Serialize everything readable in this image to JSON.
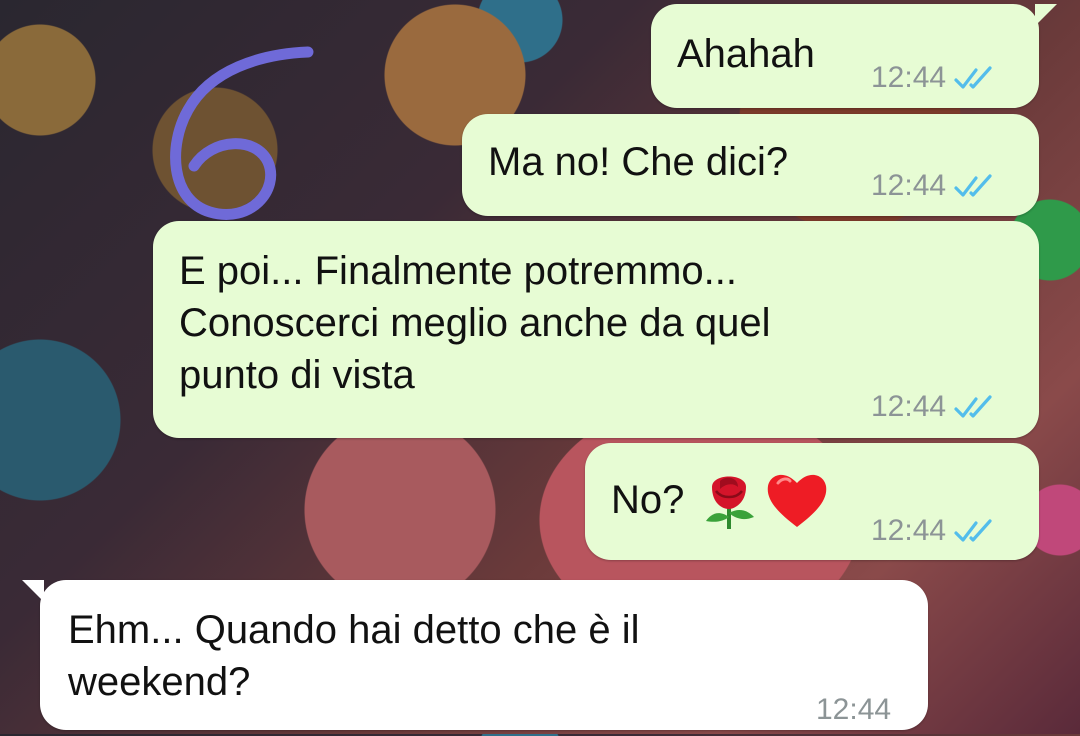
{
  "messages": [
    {
      "id": "m1",
      "direction": "outgoing",
      "text": "Ahahah",
      "time": "12:44",
      "status": "read"
    },
    {
      "id": "m2",
      "direction": "outgoing",
      "text": "Ma no! Che dici?",
      "time": "12:44",
      "status": "read"
    },
    {
      "id": "m3",
      "direction": "outgoing",
      "text": "E poi... Finalmente potremmo...\nConoscerci meglio anche da quel\npunto di vista",
      "time": "12:44",
      "status": "read"
    },
    {
      "id": "m4",
      "direction": "outgoing",
      "text": "No?",
      "emojis": [
        "rose-emoji",
        "red-heart-emoji"
      ],
      "time": "12:44",
      "status": "read"
    },
    {
      "id": "m5",
      "direction": "incoming",
      "text": "Ehm... Quando hai detto che è il\nweekend?",
      "time": "12:44"
    }
  ],
  "colors": {
    "outgoing_bubble": "#e7fcd4",
    "incoming_bubble": "#ffffff",
    "read_ticks": "#53bdeb",
    "timestamp": "#8c9496",
    "annotation_stroke": "#6f6ad8"
  }
}
